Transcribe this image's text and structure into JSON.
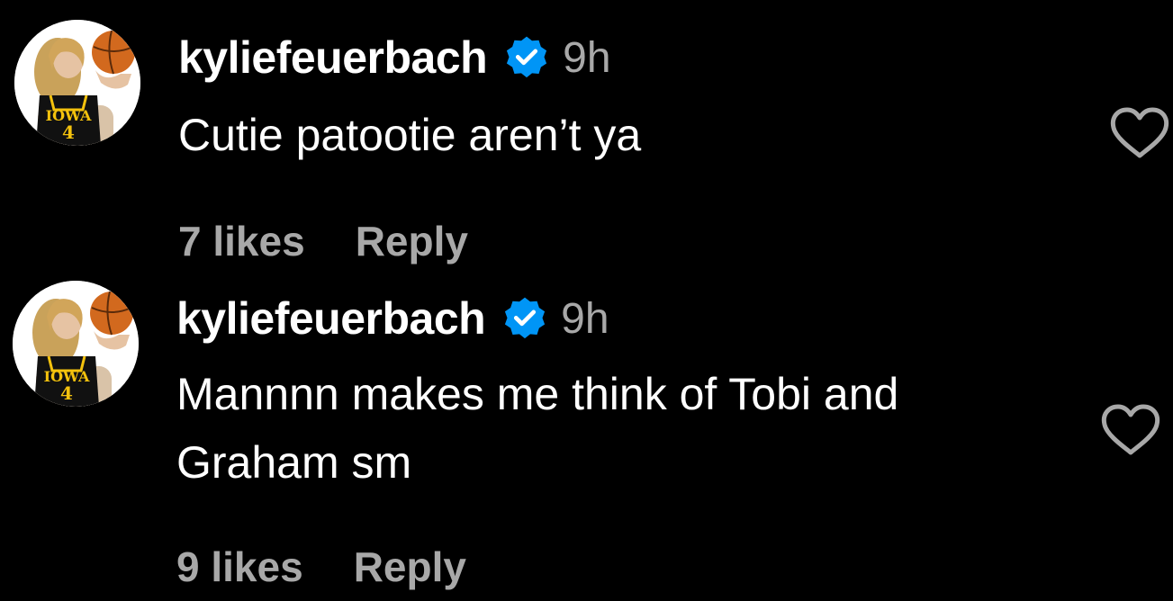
{
  "colors": {
    "background": "#000000",
    "text": "#ffffff",
    "secondary_text": "#a8a8a8",
    "verified_badge": "#0095f6"
  },
  "comments": [
    {
      "username": "kyliefeuerbach",
      "verified_icon": "verified-badge-icon",
      "timestamp": "9h",
      "text": "Cutie patootie aren’t ya",
      "likes_label": "7 likes",
      "reply_label": "Reply",
      "like_icon": "heart-outline-icon",
      "avatar": {
        "jersey_text": "IOWA",
        "jersey_number": "4"
      }
    },
    {
      "username": "kyliefeuerbach",
      "verified_icon": "verified-badge-icon",
      "timestamp": "9h",
      "text": "Mannnn makes me think of Tobi and Graham sm",
      "likes_label": "9 likes",
      "reply_label": "Reply",
      "like_icon": "heart-outline-icon",
      "avatar": {
        "jersey_text": "IOWA",
        "jersey_number": "4"
      }
    }
  ]
}
